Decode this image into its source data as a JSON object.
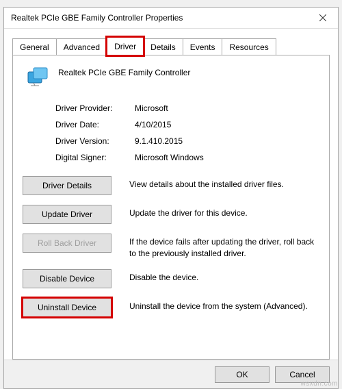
{
  "window": {
    "title": "Realtek PCIe GBE Family Controller Properties"
  },
  "tabs": {
    "items": [
      {
        "label": "General"
      },
      {
        "label": "Advanced"
      },
      {
        "label": "Driver"
      },
      {
        "label": "Details"
      },
      {
        "label": "Events"
      },
      {
        "label": "Resources"
      }
    ]
  },
  "device": {
    "name": "Realtek PCIe GBE Family Controller"
  },
  "driver_info": {
    "provider_label": "Driver Provider:",
    "provider_value": "Microsoft",
    "date_label": "Driver Date:",
    "date_value": "4/10/2015",
    "version_label": "Driver Version:",
    "version_value": "9.1.410.2015",
    "signer_label": "Digital Signer:",
    "signer_value": "Microsoft Windows"
  },
  "actions": {
    "details_label": "Driver Details",
    "details_desc": "View details about the installed driver files.",
    "update_label": "Update Driver",
    "update_desc": "Update the driver for this device.",
    "rollback_label": "Roll Back Driver",
    "rollback_desc": "If the device fails after updating the driver, roll back to the previously installed driver.",
    "disable_label": "Disable Device",
    "disable_desc": "Disable the device.",
    "uninstall_label": "Uninstall Device",
    "uninstall_desc": "Uninstall the device from the system (Advanced)."
  },
  "footer": {
    "ok": "OK",
    "cancel": "Cancel"
  },
  "watermark": "wsxdn.com"
}
